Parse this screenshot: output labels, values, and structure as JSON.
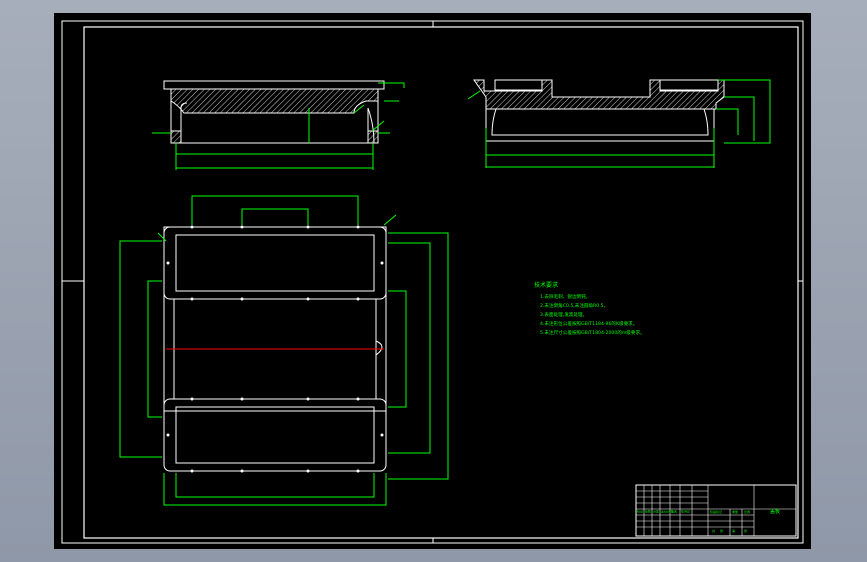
{
  "drawing": {
    "colors": {
      "background": "#000000",
      "outline": "#ffffff",
      "dimension": "#00ff00",
      "centerline": "#ff0000",
      "hatch": "#ffffff"
    },
    "technical_notes": {
      "title": "技术要求",
      "items": [
        "1.去除毛刺、锐边倒钝。",
        "2.未注倒角C0.5,未注圆角R0.5。",
        "3.表面处理,发黑处理。",
        "4.未注形位公差按照GB/T1184-96的K级要求。",
        "5.未注尺寸公差按照GB/T1804-2000的m级要求。"
      ]
    },
    "title_block": {
      "part_name": "盖板",
      "row_labels": [
        "标记",
        "处数",
        "分区",
        "更改文件号",
        "签名",
        "年月日"
      ],
      "stage_label": "阶段标记",
      "weight_label": "重量",
      "scale_label": "比例",
      "sheet_marks": [
        "共",
        "张",
        "第",
        "张"
      ]
    }
  }
}
